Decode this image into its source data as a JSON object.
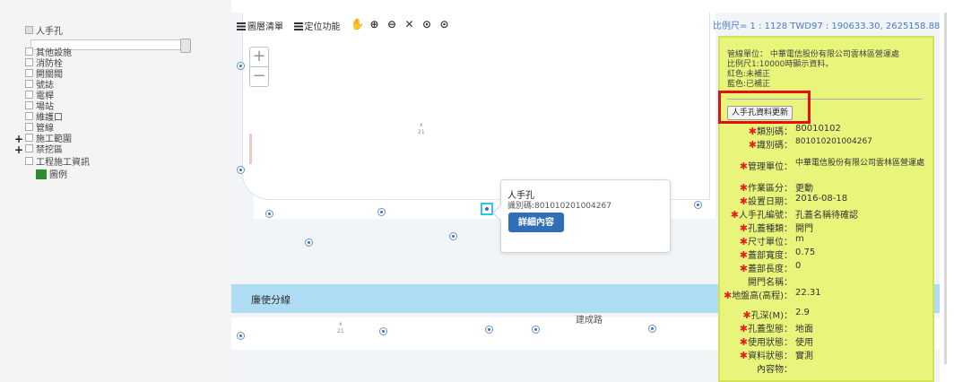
{
  "layers": {
    "manhole": "人手孔",
    "items": [
      "其他設施",
      "消防栓",
      "開關閥",
      "號誌",
      "電桿",
      "場站",
      "維護口",
      "管線",
      "施工範圍",
      "禁挖區",
      "工程施工資訊"
    ],
    "legend": "圖例"
  },
  "toolbar": {
    "layer_list": "圖層清單",
    "locate": "定位功能"
  },
  "scale_info": "比例尺= 1 : 1128   TWD97 : 190633.30, 2625158.88",
  "map": {
    "zoom_in": "+",
    "zoom_out": "−",
    "river_label": "廉使分線",
    "road_label": "建成路",
    "x_marks": [
      "x",
      "21"
    ]
  },
  "popup": {
    "title": "人手孔",
    "id_text": "識別碼:801010201004267",
    "detail_button": "詳細內容"
  },
  "panel": {
    "note_lines": [
      "管線單位： 中華電信股份有限公司雲林區營運處",
      "比例尺1:10000時顯示資料。",
      "紅色:未補正",
      "藍色:已補正"
    ],
    "update_button": "人手孔資料更新",
    "fields": [
      {
        "label": "類別碼：",
        "required": true,
        "value": "80010102"
      },
      {
        "label": "識別碼：",
        "required": true,
        "value": "801010201004267"
      },
      {
        "label": "管理單位：",
        "required": true,
        "value": "中華電信股份有限公司雲林區營運處"
      },
      {
        "label": "作業區分：",
        "required": true,
        "value": "更動"
      },
      {
        "label": "設置日期：",
        "required": true,
        "value": "2016-08-18"
      },
      {
        "label": "人手孔編號：",
        "required": true,
        "value": "孔蓋名稱待確認"
      },
      {
        "label": "孔蓋種類：",
        "required": true,
        "value": "開門"
      },
      {
        "label": "尺寸單位：",
        "required": true,
        "value": "m"
      },
      {
        "label": "蓋部寬度：",
        "required": true,
        "value": "0.75"
      },
      {
        "label": "蓋部長度：",
        "required": true,
        "value": "0"
      },
      {
        "label": "開門名稱：",
        "required": false,
        "value": ""
      },
      {
        "label": "地盤高(高程)：",
        "required": true,
        "value": "22.31"
      },
      {
        "label": "孔深(M)：",
        "required": true,
        "value": "2.9"
      },
      {
        "label": "孔蓋型態：",
        "required": true,
        "value": "地面"
      },
      {
        "label": "使用狀態：",
        "required": true,
        "value": "使用"
      },
      {
        "label": "資料狀態：",
        "required": true,
        "value": "實測"
      },
      {
        "label": "內容物：",
        "required": false,
        "value": ""
      }
    ]
  },
  "colors": {
    "panel_bg": "#e8f57a",
    "highlight": "#e41010",
    "detail_button": "#2f6fb8",
    "river": "#aedcf2",
    "legend_swatch": "#2e8b2e"
  }
}
